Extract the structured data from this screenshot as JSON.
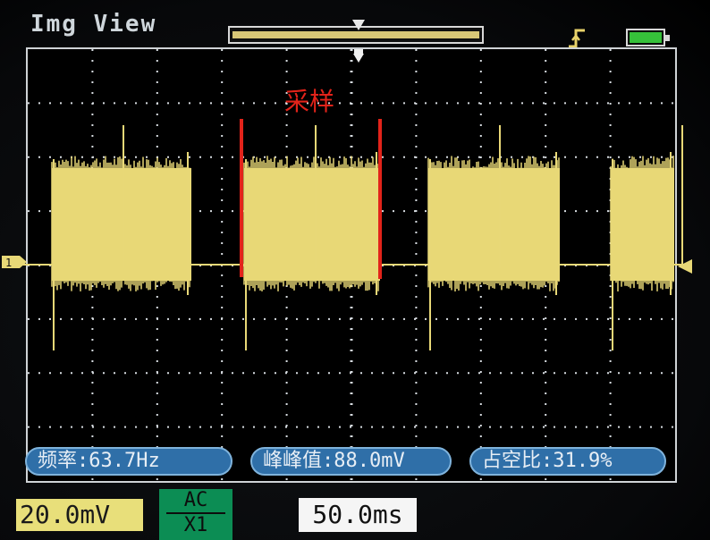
{
  "header": {
    "title": "Img View"
  },
  "annotation": {
    "label": "采样",
    "color": "#e2231a"
  },
  "measurements": {
    "frequency": "频率:63.7Hz",
    "peak_to_peak": "峰峰值:88.0mV",
    "duty_cycle": "占空比:31.9%"
  },
  "footer": {
    "volt_div": "20.0mV",
    "coupling_mode": "AC",
    "probe": "X1",
    "time_div": "50.0ms"
  },
  "markers": {
    "channel": "1"
  },
  "colors": {
    "trace": "#e8d877",
    "grid": "#d6dbe0",
    "panel": "#2f6fa8",
    "marker": "#e2231a"
  },
  "icons": {
    "trigger": "rising-edge-icon",
    "battery": "battery-full-icon"
  }
}
